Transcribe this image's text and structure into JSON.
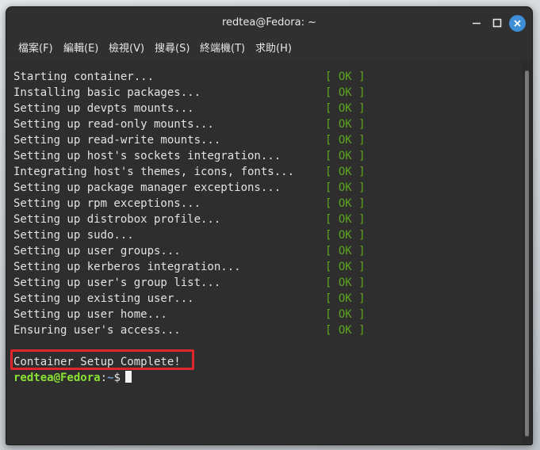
{
  "window": {
    "title": "redtea@Fedora: ~"
  },
  "menu": [
    {
      "label": "檔案(F)"
    },
    {
      "label": "編輯(E)"
    },
    {
      "label": "檢視(V)"
    },
    {
      "label": "搜尋(S)"
    },
    {
      "label": "終端機(T)"
    },
    {
      "label": "求助(H)"
    }
  ],
  "terminal": {
    "lines": [
      {
        "text": "Starting container...",
        "status": "[ OK ]"
      },
      {
        "text": "Installing basic packages...",
        "status": "[ OK ]"
      },
      {
        "text": "Setting up devpts mounts...",
        "status": "[ OK ]"
      },
      {
        "text": "Setting up read-only mounts...",
        "status": "[ OK ]"
      },
      {
        "text": "Setting up read-write mounts...",
        "status": "[ OK ]"
      },
      {
        "text": "Setting up host's sockets integration...",
        "status": "[ OK ]"
      },
      {
        "text": "Integrating host's themes, icons, fonts...",
        "status": "[ OK ]"
      },
      {
        "text": "Setting up package manager exceptions...",
        "status": "[ OK ]"
      },
      {
        "text": "Setting up rpm exceptions...",
        "status": "[ OK ]"
      },
      {
        "text": "Setting up distrobox profile...",
        "status": "[ OK ]"
      },
      {
        "text": "Setting up sudo...",
        "status": "[ OK ]"
      },
      {
        "text": "Setting up user groups...",
        "status": "[ OK ]"
      },
      {
        "text": "Setting up kerberos integration...",
        "status": "[ OK ]"
      },
      {
        "text": "Setting up user's group list...",
        "status": "[ OK ]"
      },
      {
        "text": "Setting up existing user...",
        "status": "[ OK ]"
      },
      {
        "text": "Setting up user home...",
        "status": "[ OK ]"
      },
      {
        "text": "Ensuring user's access...",
        "status": "[ OK ]"
      }
    ],
    "complete_message": "Container Setup Complete!",
    "prompt": {
      "user_host": "redtea@Fedora",
      "separator": ":",
      "path": "~",
      "symbol": "$"
    }
  },
  "colors": {
    "ok_status": "#5ea51f",
    "prompt_user": "#8ae234",
    "prompt_path": "#729fcf",
    "highlight_box": "#e0252b",
    "close_button": "#3f8fd8"
  },
  "icons": [
    "minimize-icon",
    "maximize-icon",
    "close-icon"
  ]
}
